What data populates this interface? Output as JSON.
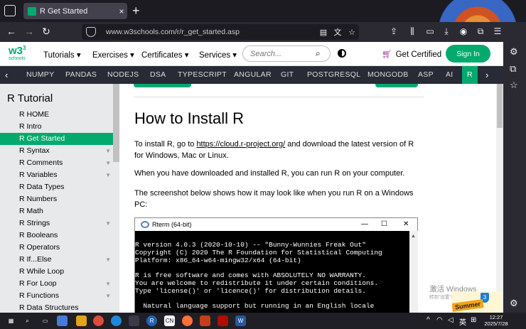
{
  "browser": {
    "tab_title": "R Get Started",
    "tab_close": "×",
    "new_tab": "+",
    "url": "www.w3schools.com/r/r_get_started.asp"
  },
  "header": {
    "logo_main": "w3",
    "logo_sup": "3",
    "logo_sub": "schools",
    "menu": [
      "Tutorials",
      "Exercises",
      "Certificates",
      "Services"
    ],
    "search_placeholder": "Search...",
    "get_certified": "Get Certified",
    "sign_in": "Sign In"
  },
  "topics": [
    "NUMPY",
    "PANDAS",
    "NODEJS",
    "DSA",
    "TYPESCRIPT",
    "ANGULAR",
    "GIT",
    "POSTGRESQL",
    "MONGODB",
    "ASP",
    "AI",
    "R"
  ],
  "sidebar": {
    "heading": "R Tutorial",
    "items": [
      "R HOME",
      "R Intro",
      "R Get Started",
      "R Syntax",
      "R Comments",
      "R Variables",
      "R Data Types",
      "R Numbers",
      "R Math",
      "R Strings",
      "R Booleans",
      "R Operators",
      "R If...Else",
      "R While Loop",
      "R For Loop",
      "R Functions",
      "R Data Structures"
    ]
  },
  "content": {
    "title": "How to Install R",
    "p1_before": "To install R, go to ",
    "p1_link": "https://cloud.r-project.org/",
    "p1_after": " and download the latest version of R for Windows, Mac or Linux.",
    "p2": "When you have downloaded and installed R, you can run R on your computer.",
    "p3": "The screenshot below shows how it may look like when you run R on a Windows PC:"
  },
  "rterm": {
    "title": "Rterm (64-bit)",
    "lines": [
      "R version 4.0.3 (2020-10-10) -- \"Bunny-Wunnies Freak Out\"",
      "Copyright (C) 2020 The R Foundation for Statistical Computing",
      "Platform: x86_64-w64-mingw32/x64 (64-bit)",
      "",
      "R is free software and comes with ABSOLUTELY NO WARRANTY.",
      "You are welcome to redistribute it under certain conditions.",
      "Type 'license()' or 'licence()' for distribution details.",
      "",
      "  Natural language support but running in an English locale"
    ]
  },
  "overlay": {
    "watermark": "激活 Windows",
    "watermark_sub": "转到\"设置\"以激活 Windows。",
    "promo": "Summer"
  },
  "taskbar": {
    "lang": "英",
    "time": "12:27",
    "date": "2025/7/28"
  }
}
